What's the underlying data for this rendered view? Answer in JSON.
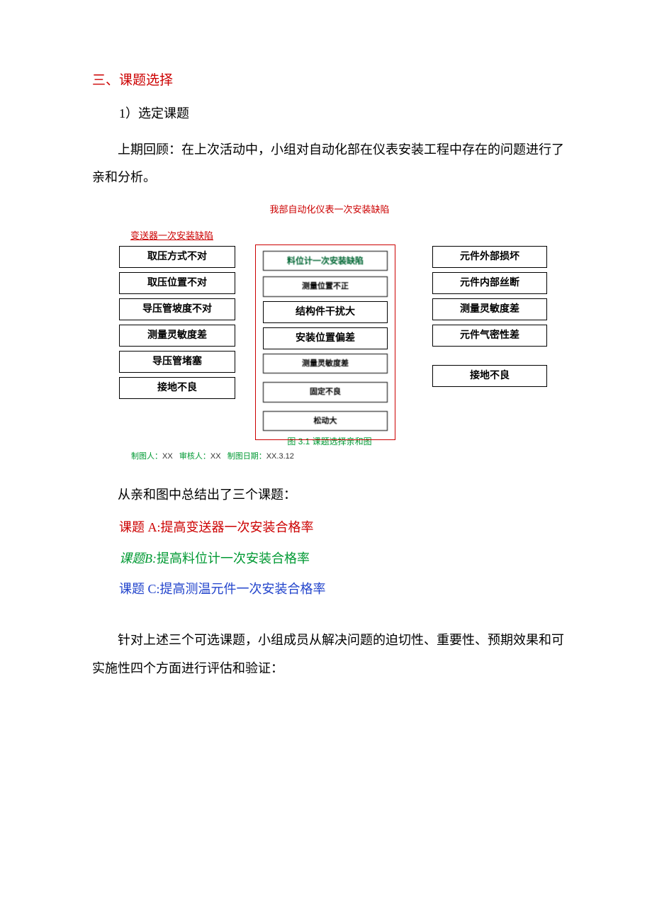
{
  "heading": "三、课题选择",
  "sub1": "1）选定课题",
  "para1": "上期回顾：在上次活动中，小组对自动化部在仪表安装工程中存在的问题进行了亲和分析。",
  "diagram": {
    "title": "我部自动化仪表一次安装缺陷",
    "col1": {
      "header": "变送器一次安装缺陷",
      "items": [
        "取压方式不对",
        "取压位置不对",
        "导压管坡度不对",
        "测量灵敏度差",
        "导压管堵塞",
        "接地不良"
      ]
    },
    "col2": {
      "header": "料位计一次安装缺陷",
      "items": [
        "测量位置不正",
        "结构件干扰大",
        "安装位置偏差",
        "测量灵敏度差",
        "固定不良",
        "松动大"
      ]
    },
    "col3": {
      "items": [
        "元件外部损坏",
        "元件内部丝断",
        "测量灵敏度差",
        "元件气密性差",
        "接地不良"
      ]
    },
    "caption": "图 3.1 课题选择亲和图",
    "credit_prefix1": "制图人：",
    "credit_v1": "XX",
    "credit_prefix2": "审核人：",
    "credit_v2": "XX",
    "credit_prefix3": "制图日期：",
    "credit_v3": "XX.3.12"
  },
  "summary": "从亲和图中总结出了三个课题：",
  "topicA": {
    "label": "课题 A:",
    "text": "提高变送器一次安装合格率"
  },
  "topicB": {
    "label": "课题B:",
    "text": "提高料位计一次安装合格率"
  },
  "topicC": {
    "label": "课题 C:",
    "text": "提高测温元件一次安装合格率"
  },
  "para2": "针对上述三个可选课题，小组成员从解决问题的迫切性、重要性、预期效果和可实施性四个方面进行评估和验证："
}
